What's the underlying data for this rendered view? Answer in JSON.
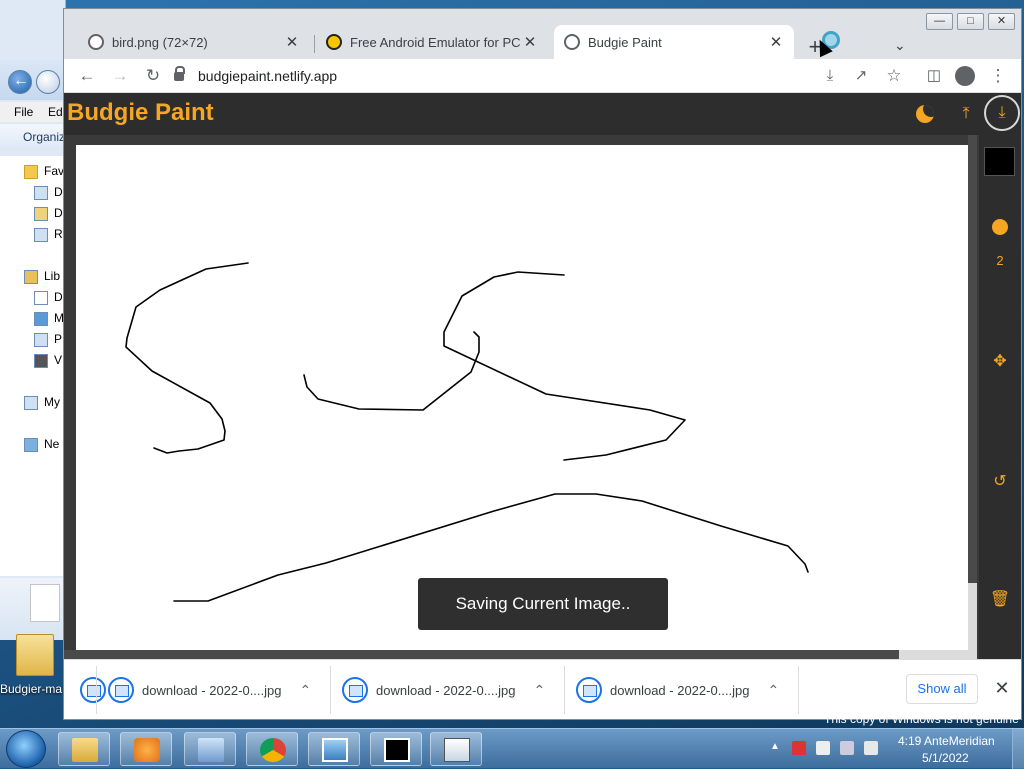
{
  "explorer": {
    "menu": [
      "File",
      "Ed"
    ],
    "toolbar_label": "Organiz",
    "favorites_label": "Fav",
    "libraries_label": "Lib",
    "lib_items": [
      "D",
      "M",
      "P",
      "V"
    ],
    "fav_items": [
      "D",
      "D",
      "R"
    ],
    "computer_label": "My",
    "network_label": "Ne"
  },
  "desktop": {
    "folder_label": "Budgier-ma"
  },
  "browser": {
    "tabs": [
      {
        "title": "bird.png (72×72)",
        "active": false
      },
      {
        "title": "Free Android Emulator for PC - D",
        "active": false
      },
      {
        "title": "Budgie Paint",
        "active": true
      }
    ],
    "url": "budgiepaint.netlify.app"
  },
  "app": {
    "title": "Budgie Paint",
    "brush_size": "2",
    "color": "#000000",
    "accent": "#f5a623",
    "toast": "Saving Current Image.."
  },
  "downloads": {
    "items": [
      "download - 2022-0....jpg",
      "download - 2022-0....jpg",
      "download - 2022-0....jpg"
    ],
    "show_all": "Show all"
  },
  "system": {
    "watermark": "This copy of Windows is not genuine",
    "time": "4:19 AnteMeridian",
    "date": "5/1/2022"
  }
}
